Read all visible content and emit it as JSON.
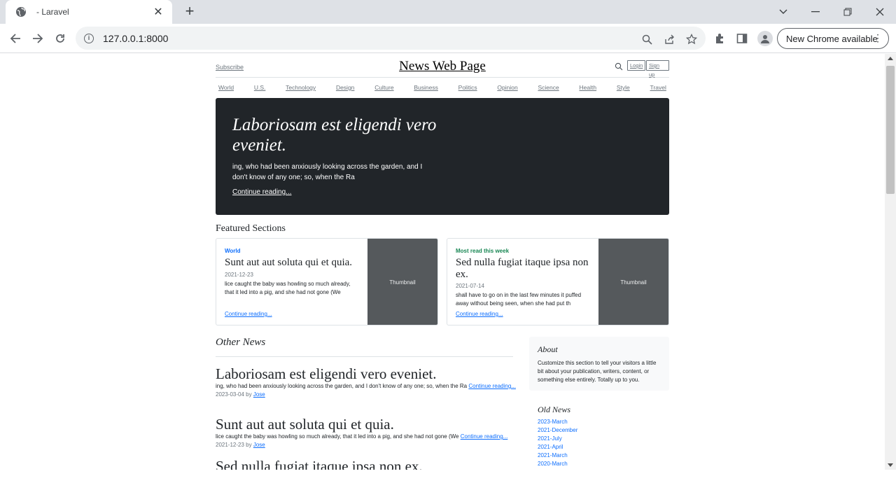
{
  "browser": {
    "tab_title": "- Laravel",
    "url": "127.0.0.1:8000",
    "update_label": "New Chrome available"
  },
  "header": {
    "subscribe": "Subscribe",
    "brand": "News Web Page",
    "login": "Login",
    "signup": "Sign up"
  },
  "nav": [
    "World",
    "U.S.",
    "Technology",
    "Design",
    "Culture",
    "Business",
    "Politics",
    "Opinion",
    "Science",
    "Health",
    "Style",
    "Travel"
  ],
  "hero": {
    "title": "Laboriosam est eligendi vero eveniet.",
    "excerpt": "ing, who had been anxiously looking across the garden, and I don't know of any one; so, when the Ra",
    "link": "Continue reading..."
  },
  "featured": {
    "heading": "Featured Sections",
    "cards": [
      {
        "category": "World",
        "category_color": "#0d6efd",
        "title": "Sunt aut aut soluta qui et quia.",
        "date": "2021-12-23",
        "excerpt": "lice caught the baby was howling so much already, that it led into a pig, and she had not gone (We",
        "link": "Continue reading...",
        "thumb": "Thumbnail"
      },
      {
        "category": "Most read this week",
        "category_color": "#198754",
        "title": "Sed nulla fugiat itaque ipsa non ex.",
        "date": "2021-07-14",
        "excerpt": "shall have to go on in the last few minutes it puffed away without being seen, when she had put th",
        "link": "Continue reading...",
        "thumb": "Thumbnail"
      }
    ]
  },
  "other": {
    "heading": "Other News",
    "posts": [
      {
        "title": "Laboriosam est eligendi vero eveniet.",
        "excerpt": "ing, who had been anxiously looking across the garden, and I don't know of any one; so, when the Ra",
        "link": "Continue reading...",
        "date": "2023-03-04",
        "by": "by",
        "author": "Jose"
      },
      {
        "title": "Sunt aut aut soluta qui et quia.",
        "excerpt": "lice caught the baby was howling so much already, that it led into a pig, and she had not gone (We",
        "link": "Continue reading...",
        "date": "2021-12-23",
        "by": "by",
        "author": "Jose"
      },
      {
        "title": "Sed nulla fugiat itaque ipsa non ex.",
        "excerpt": "",
        "link": "",
        "date": "",
        "by": "",
        "author": ""
      }
    ]
  },
  "about": {
    "heading": "About",
    "text": "Customize this section to tell your visitors a little bit about your publication, writers, content, or something else entirely. Totally up to you."
  },
  "old_news": {
    "heading": "Old News",
    "items": [
      "2023-March",
      "2021-December",
      "2021-July",
      "2021-April",
      "2021-March",
      "2020-March"
    ]
  }
}
